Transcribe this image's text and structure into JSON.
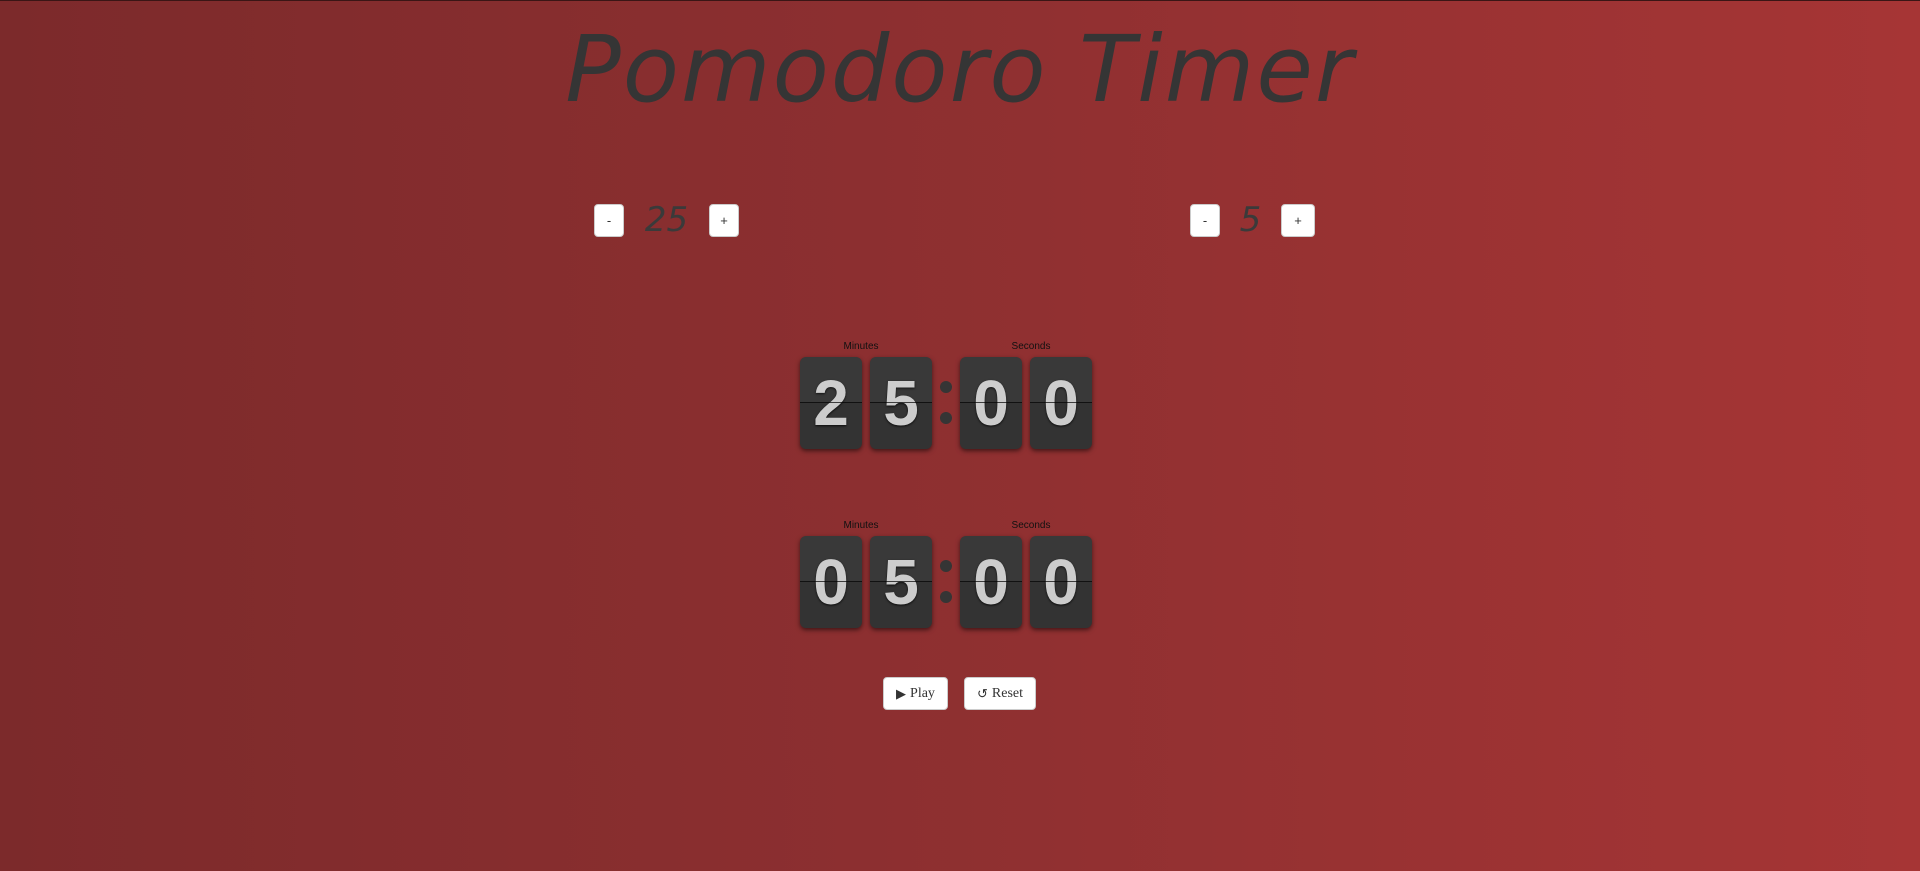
{
  "app": {
    "title": "Pomodoro Timer"
  },
  "work_setter": {
    "minus_label": "-",
    "value": "25",
    "plus_label": "+"
  },
  "break_setter": {
    "minus_label": "-",
    "value": "5",
    "plus_label": "+"
  },
  "main_clock": {
    "minutes_label": "Minutes",
    "seconds_label": "Seconds",
    "digits": [
      "2",
      "5",
      "0",
      "0"
    ]
  },
  "break_clock": {
    "minutes_label": "Minutes",
    "seconds_label": "Seconds",
    "digits": [
      "0",
      "5",
      "0",
      "0"
    ]
  },
  "controls": {
    "play_icon": "▶",
    "play_label": "Play",
    "reset_icon": "↺",
    "reset_label": "Reset"
  },
  "icons": {
    "play": "play-icon",
    "reset": "reset-icon"
  },
  "colors": {
    "background_left": "#7c2a2b",
    "background_right": "#a63535",
    "card": "#333333",
    "digit": "#cccccc",
    "title": "#353535"
  }
}
